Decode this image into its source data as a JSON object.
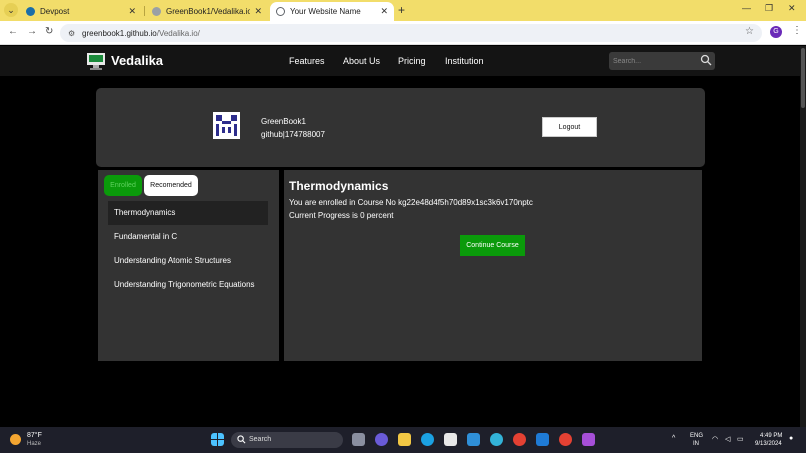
{
  "browser": {
    "tabs": [
      {
        "title": "Devpost",
        "favicon_color": "#1a6ea8",
        "active": false
      },
      {
        "title": "GreenBook1/Vedalika.io",
        "favicon_color": "#9aa0a6",
        "active": false
      },
      {
        "title": "Your Website Name",
        "favicon_color": "#5f6368",
        "active": true
      }
    ],
    "address": {
      "host": "greenbook1.github.io",
      "path": "/Vedalika.io/"
    },
    "profile_initial": "G"
  },
  "site": {
    "brand": "Vedalika",
    "nav": [
      "Features",
      "About Us",
      "Pricing",
      "Institution"
    ],
    "search_placeholder": "Search...",
    "user": {
      "name": "GreenBook1",
      "github": "github|174788007"
    },
    "logout_label": "Logout",
    "tabs": {
      "enrolled": "Enrolled",
      "recommended": "Recomended"
    },
    "courses": [
      "Thermodynamics",
      "Fundamental in C",
      "Understanding Atomic Structures",
      "Understanding Trigonometric Equations"
    ],
    "detail": {
      "title": "Thermodynamics",
      "enrolled_line": "You are enrolled in Course No kg22e48d4f5h70d89x1sc3k6v170nptc",
      "progress_line": "Current Progress is 0 percent",
      "continue_label": "Continue Course"
    },
    "colors": {
      "accent_green": "#0a9a0a",
      "panel": "#333333",
      "nav": "#141414"
    }
  },
  "taskbar": {
    "weather_temp": "87°F",
    "weather_desc": "Haze",
    "search_label": "Search",
    "lang_top": "ENG",
    "lang_bottom": "IN",
    "time": "4:49 PM",
    "date": "9/13/2024"
  }
}
